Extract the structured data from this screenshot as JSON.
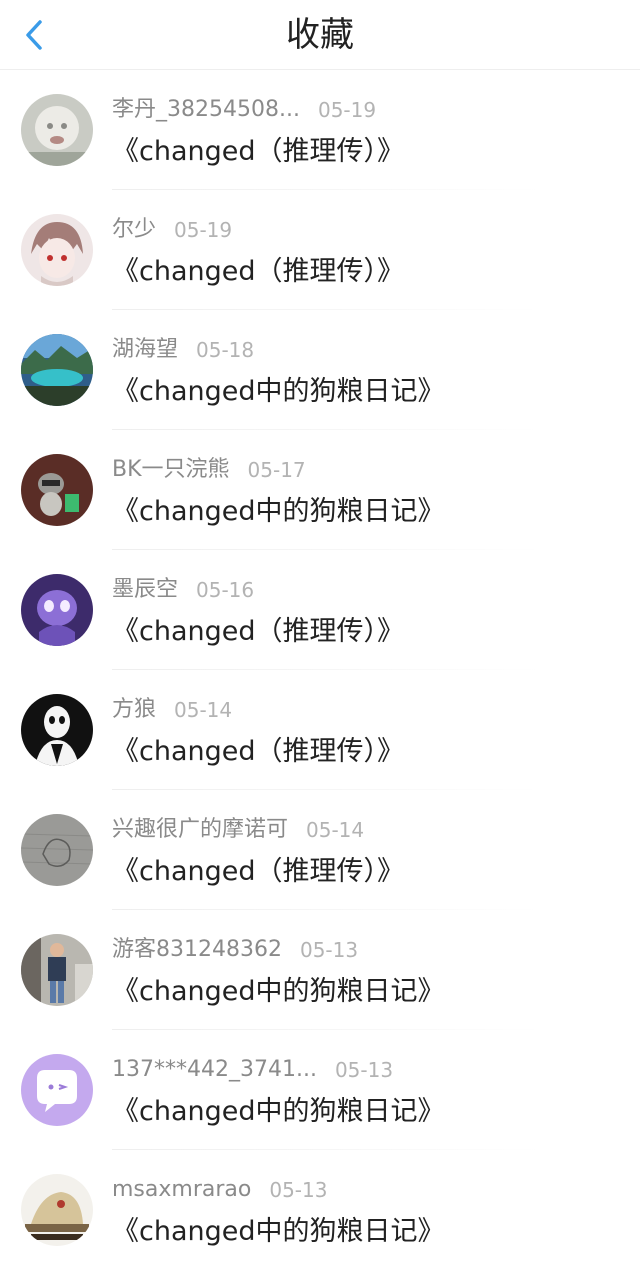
{
  "header": {
    "title": "收藏",
    "back_icon": "chevron-left-icon",
    "accent": "#3a9be8"
  },
  "favorites": [
    {
      "user": "李丹_38254508...",
      "date": "05-19",
      "book": "《changed（推理传）》",
      "avatar": "baby-photo-avatar"
    },
    {
      "user": "尔少",
      "date": "05-19",
      "book": "《changed（推理传）》",
      "avatar": "anime-character-avatar"
    },
    {
      "user": "湖海望",
      "date": "05-18",
      "book": "《changed中的狗粮日记》",
      "avatar": "lake-landscape-avatar"
    },
    {
      "user": "BK一只浣熊",
      "date": "05-17",
      "book": "《changed中的狗粮日记》",
      "avatar": "raccoon-avatar"
    },
    {
      "user": "墨辰空",
      "date": "05-16",
      "book": "《changed（推理传）》",
      "avatar": "purple-creature-avatar"
    },
    {
      "user": "方狼",
      "date": "05-14",
      "book": "《changed（推理传）》",
      "avatar": "masked-figure-avatar"
    },
    {
      "user": "兴趣很广的摩诺可",
      "date": "05-14",
      "book": "《changed（推理传）》",
      "avatar": "sketch-avatar"
    },
    {
      "user": "游客831248362",
      "date": "05-13",
      "book": "《changed中的狗粮日记》",
      "avatar": "person-photo-avatar"
    },
    {
      "user": "137***442_3741...",
      "date": "05-13",
      "book": "《changed中的狗粮日记》",
      "avatar": "chat-bubble-avatar"
    },
    {
      "user": "msaxmrarao",
      "date": "05-13",
      "book": "《changed中的狗粮日记》",
      "avatar": "hat-photo-avatar"
    }
  ]
}
